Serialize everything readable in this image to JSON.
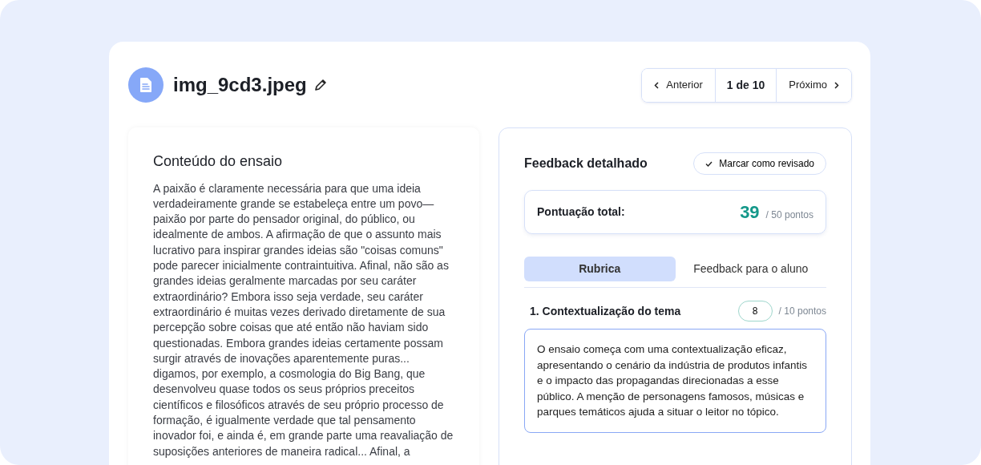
{
  "header": {
    "title": "img_9cd3.jpeg"
  },
  "pager": {
    "previous": "Anterior",
    "position": "1 de 10",
    "next": "Próximo"
  },
  "essay": {
    "title": "Conteúdo do ensaio",
    "text": "A paixão é claramente necessária para que uma ideia verdadeiramente grande se estabeleça entre um povo—paixão por parte do pensador original, do público, ou idealmente de ambos. A afirmação de que o assunto mais lucrativo para inspirar grandes ideias são \"coisas comuns\" pode parecer inicialmente contraintuitiva. Afinal, não são as grandes ideias geralmente marcadas por seu caráter extraordinário? Embora isso seja verdade, seu caráter extraordinário é muitas vezes derivado diretamente de sua percepção sobre coisas que até então não haviam sido questionadas. Embora grandes ideias certamente possam surgir através de inovações aparentemente puras... digamos, por exemplo, a cosmologia do Big Bang, que desenvolveu quase todos os seus próprios preceitos científicos e filosóficos através de seu próprio processo de formação, é igualmente verdade que tal pensamento inovador foi, e ainda é, em grande parte uma reavaliação de suposições anteriores de maneira radical... Afinal, a"
  },
  "feedback": {
    "title": "Feedback detalhado",
    "review_button": "Marcar como revisado",
    "total": {
      "label": "Pontuação total:",
      "score": "39",
      "max": "/ 50 pontos"
    },
    "tabs": [
      {
        "label": "Rubrica",
        "selected": true
      },
      {
        "label": "Feedback para o aluno",
        "selected": false
      }
    ],
    "criteria": [
      {
        "title": "1. Contextualização do tema",
        "score": "8",
        "max": "/ 10 pontos",
        "comment": "O ensaio começa com uma contextualização eficaz, apresentando o cenário da indústria de produtos infantis e o impacto das propagandas direcionadas a esse público. A menção de personagens famosos, músicas e parques temáticos ajuda a situar o leitor no tópico."
      }
    ]
  }
}
